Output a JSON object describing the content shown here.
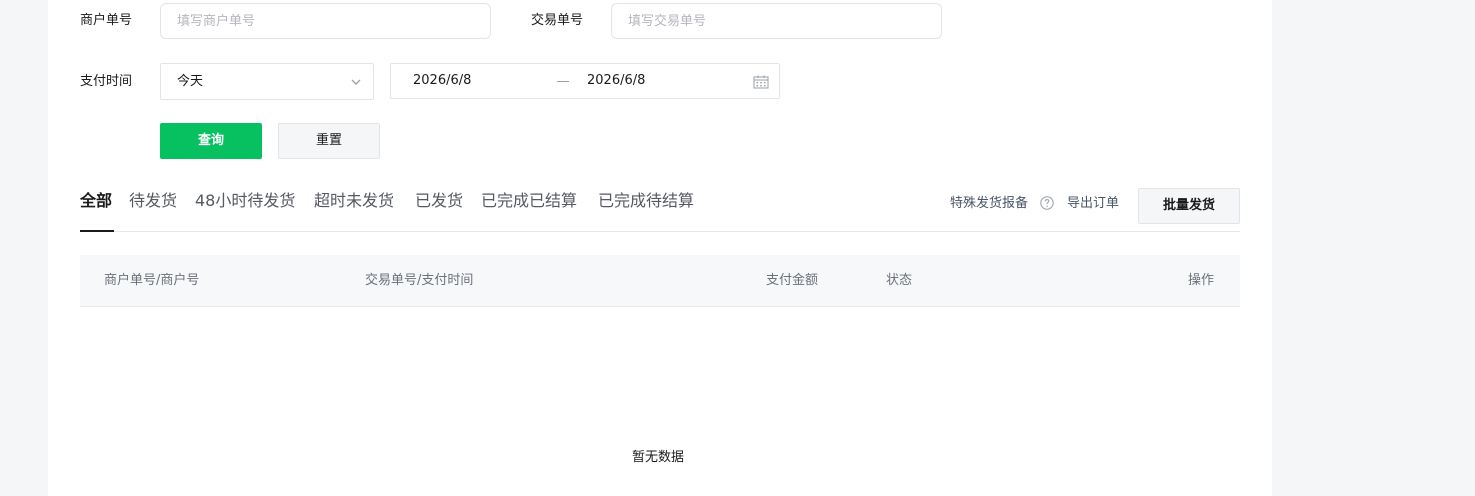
{
  "filters": {
    "merchant_no_label": "商户单号",
    "merchant_no_placeholder": "填写商户单号",
    "trade_no_label": "交易单号",
    "trade_no_placeholder": "填写交易单号",
    "pay_time_label": "支付时间",
    "pay_time_select": "今天",
    "date_start": "2026/6/8",
    "date_end": "2026/6/8"
  },
  "actions": {
    "query_label": "查询",
    "reset_label": "重置"
  },
  "tabs": [
    {
      "label": "全部",
      "active": true
    },
    {
      "label": "待发货"
    },
    {
      "label": "48小时待发货"
    },
    {
      "label": "超时未发货"
    },
    {
      "label": "已发货"
    },
    {
      "label": "已完成已结算"
    },
    {
      "label": "已完成待结算"
    }
  ],
  "toolbar": {
    "special_report_label": "特殊发货报备",
    "export_label": "导出订单",
    "batch_ship_label": "批量发货"
  },
  "table": {
    "columns": [
      "商户单号/商户号",
      "交易单号/支付时间",
      "支付金额",
      "状态",
      "操作"
    ],
    "empty_text": "暂无数据"
  },
  "colors": {
    "primary": "#07c160",
    "background": "#f5f6f8"
  }
}
